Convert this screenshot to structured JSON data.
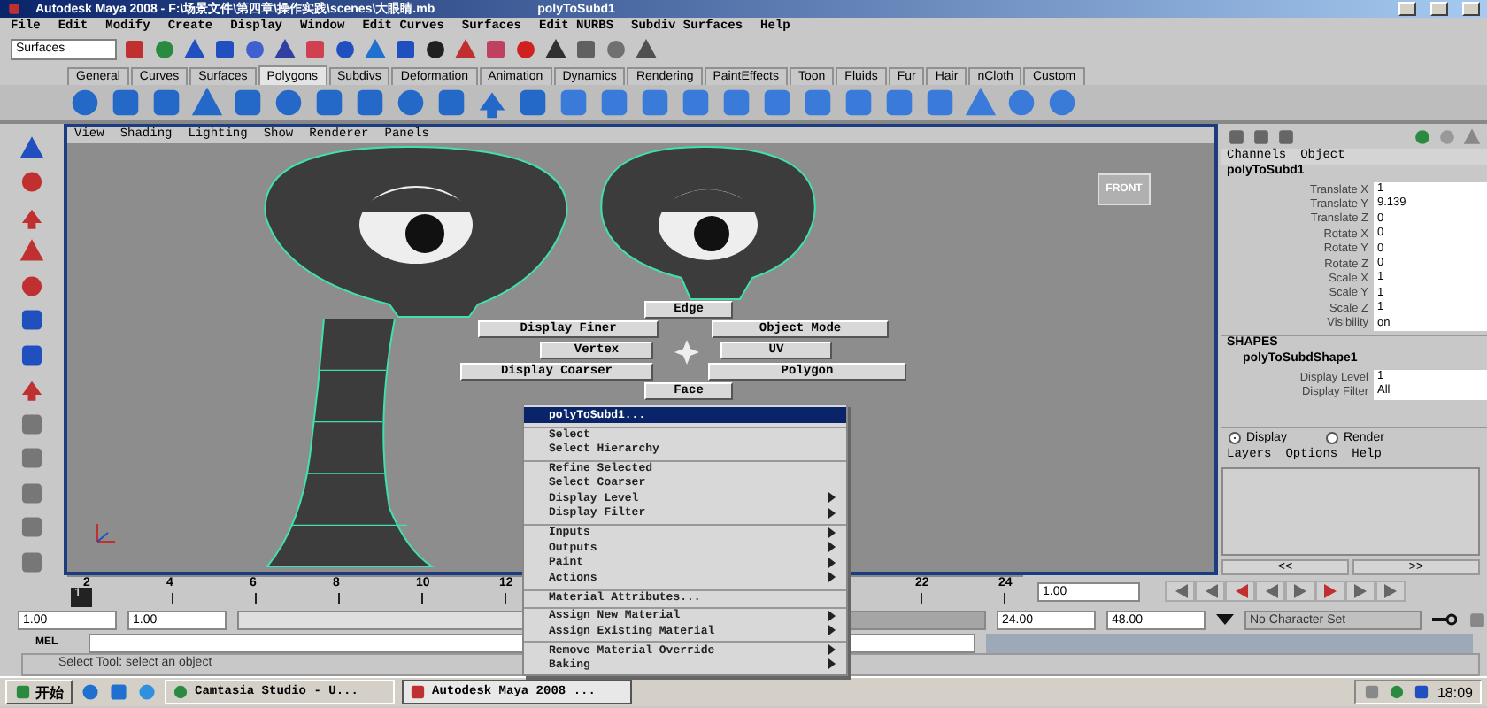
{
  "window": {
    "title": "Autodesk Maya 2008 - F:\\场景文件\\第四章\\操作实践\\scenes\\大眼睛.mb",
    "document": "polyToSubd1"
  },
  "menu": [
    "File",
    "Edit",
    "Modify",
    "Create",
    "Display",
    "Window",
    "Edit Curves",
    "Surfaces",
    "Edit NURBS",
    "Subdiv Surfaces",
    "Help"
  ],
  "status_line": {
    "menu_set": "Surfaces"
  },
  "shelf": {
    "tabs": [
      {
        "label": "General",
        "selected": false
      },
      {
        "label": "Curves",
        "selected": false
      },
      {
        "label": "Surfaces",
        "selected": false
      },
      {
        "label": "Polygons",
        "selected": true
      },
      {
        "label": "Subdivs",
        "selected": false
      },
      {
        "label": "Deformation",
        "selected": false
      },
      {
        "label": "Animation",
        "selected": false
      },
      {
        "label": "Dynamics",
        "selected": false
      },
      {
        "label": "Rendering",
        "selected": false
      },
      {
        "label": "PaintEffects",
        "selected": false
      },
      {
        "label": "Toon",
        "selected": false
      },
      {
        "label": "Fluids",
        "selected": false
      },
      {
        "label": "Fur",
        "selected": false
      },
      {
        "label": "Hair",
        "selected": false
      },
      {
        "label": "nCloth",
        "selected": false
      },
      {
        "label": "Custom",
        "selected": false
      }
    ]
  },
  "viewport": {
    "menu": [
      "View",
      "Shading",
      "Lighting",
      "Show",
      "Renderer",
      "Panels"
    ],
    "view_cube": "FRONT",
    "marking_menu": [
      "Edge",
      "Display Finer",
      "Object Mode",
      "Vertex",
      "UV",
      "Display Coarser",
      "Polygon",
      "Face"
    ]
  },
  "context_menu": {
    "items": [
      {
        "label": "polyToSubd1...",
        "selected": true,
        "submenu": false,
        "group_start": false
      },
      {
        "label": "Select",
        "selected": false,
        "submenu": false,
        "group_start": true
      },
      {
        "label": "Select Hierarchy",
        "selected": false,
        "submenu": false,
        "group_start": false
      },
      {
        "label": "Refine Selected",
        "selected": false,
        "submenu": false,
        "group_start": true
      },
      {
        "label": "Select Coarser",
        "selected": false,
        "submenu": false,
        "group_start": false
      },
      {
        "label": "Display Level",
        "selected": false,
        "submenu": true,
        "group_start": false
      },
      {
        "label": "Display Filter",
        "selected": false,
        "submenu": true,
        "group_start": false
      },
      {
        "label": "Inputs",
        "selected": false,
        "submenu": true,
        "group_start": true
      },
      {
        "label": "Outputs",
        "selected": false,
        "submenu": true,
        "group_start": false
      },
      {
        "label": "Paint",
        "selected": false,
        "submenu": true,
        "group_start": false
      },
      {
        "label": "Actions",
        "selected": false,
        "submenu": true,
        "group_start": false
      },
      {
        "label": "Material Attributes...",
        "selected": false,
        "submenu": false,
        "group_start": true
      },
      {
        "label": "Assign New Material",
        "selected": false,
        "submenu": true,
        "group_start": true
      },
      {
        "label": "Assign Existing Material",
        "selected": false,
        "submenu": true,
        "group_start": false
      },
      {
        "label": "Remove Material Override",
        "selected": false,
        "submenu": true,
        "group_start": true
      },
      {
        "label": "Baking",
        "selected": false,
        "submenu": true,
        "group_start": false
      }
    ]
  },
  "channel_box": {
    "menu": [
      "Channels",
      "Object"
    ],
    "node": "polyToSubd1",
    "attributes": [
      {
        "name": "Translate X",
        "value": "1"
      },
      {
        "name": "Translate Y",
        "value": "9.139"
      },
      {
        "name": "Translate Z",
        "value": "0"
      },
      {
        "name": "Rotate X",
        "value": "0"
      },
      {
        "name": "Rotate Y",
        "value": "0"
      },
      {
        "name": "Rotate Z",
        "value": "0"
      },
      {
        "name": "Scale X",
        "value": "1"
      },
      {
        "name": "Scale Y",
        "value": "1"
      },
      {
        "name": "Scale Z",
        "value": "1"
      },
      {
        "name": "Visibility",
        "value": "on"
      }
    ],
    "shapes_heading": "SHAPES",
    "shape_node": "polyToSubdShape1",
    "shape_attributes": [
      {
        "name": "Display Level",
        "value": "1"
      },
      {
        "name": "Display Filter",
        "value": "All"
      }
    ]
  },
  "layers": {
    "modes": [
      {
        "label": "Display",
        "selected": true
      },
      {
        "label": "Render",
        "selected": false
      }
    ],
    "menu": [
      "Layers",
      "Options",
      "Help"
    ],
    "scroll": [
      "<<",
      ">>"
    ]
  },
  "time_slider": {
    "current": "1",
    "level": 0,
    "ticks_start": [
      "2",
      "4",
      "6",
      "8",
      "10",
      "12"
    ],
    "ticks_end": [
      "22",
      "24"
    ],
    "current_time": "1.00"
  },
  "range_slider": {
    "level": 0.5,
    "start": "1.00",
    "range_start": "1.00",
    "range_end": "24.00",
    "end": "48.00",
    "character_set": "No Character Set"
  },
  "command_line": {
    "label": "MEL"
  },
  "help_line": "Select Tool: select an object",
  "taskbar": {
    "start": "开始",
    "tasks": [
      {
        "label": "Camtasia Studio - U...",
        "selected": false
      },
      {
        "label": "Autodesk Maya 2008 ...",
        "selected": true
      }
    ],
    "clock": "18:09"
  }
}
